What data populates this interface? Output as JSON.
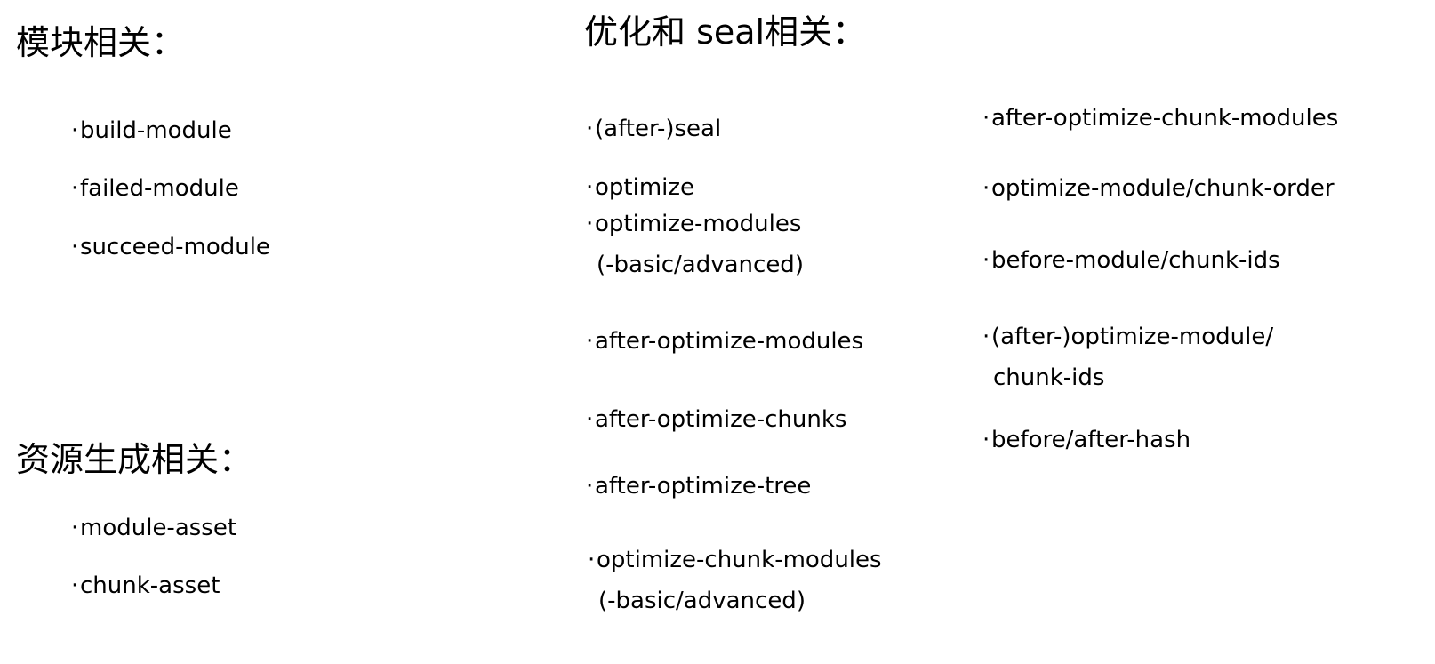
{
  "module_section": {
    "heading": "模块相关：",
    "items": [
      "build-module",
      "failed-module",
      "succeed-module"
    ]
  },
  "asset_section": {
    "heading": "资源生成相关：",
    "items": [
      "module-asset",
      "chunk-asset"
    ]
  },
  "optimize_section": {
    "heading": "优化和 seal相关：",
    "column1": [
      {
        "line1": "(after-)seal"
      },
      {
        "line1": "optimize"
      },
      {
        "line1": "optimize-modules",
        "line2": "(-basic/advanced)"
      },
      {
        "line1": "after-optimize-modules"
      },
      {
        "line1": "after-optimize-chunks"
      },
      {
        "line1": "after-optimize-tree"
      },
      {
        "line1": "optimize-chunk-modules",
        "line2": "(-basic/advanced)"
      }
    ],
    "column2": [
      {
        "line1": "after-optimize-chunk-modules"
      },
      {
        "line1": "optimize-module/chunk-order"
      },
      {
        "line1": "before-module/chunk-ids"
      },
      {
        "line1": "(after-)optimize-module/",
        "line2": "chunk-ids"
      },
      {
        "line1": "before/after-hash"
      }
    ]
  },
  "bullet_char": "·"
}
